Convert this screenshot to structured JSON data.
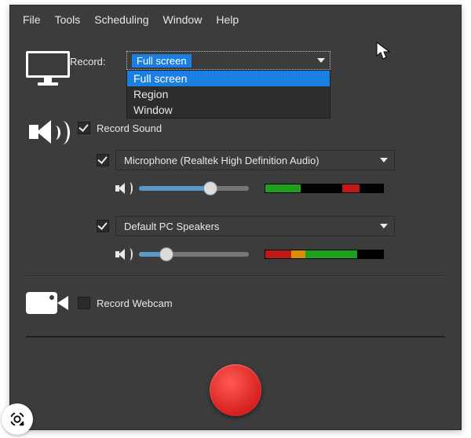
{
  "menu": {
    "file": "File",
    "tools": "Tools",
    "scheduling": "Scheduling",
    "window": "Window",
    "help": "Help"
  },
  "record_section": {
    "label": "Record:",
    "selected": "Full screen",
    "options": [
      "Full screen",
      "Region",
      "Window"
    ]
  },
  "sound_section": {
    "record_sound_label": "Record Sound",
    "record_sound_checked": true,
    "mic": {
      "enabled": true,
      "device": "Microphone (Realtek High Definition Audio)",
      "volume_percent": 65,
      "meter": [
        {
          "color": "#1ea01e",
          "from": 0,
          "to": 30
        },
        {
          "color": "#000000",
          "from": 30,
          "to": 65
        },
        {
          "color": "#c01818",
          "from": 65,
          "to": 80
        },
        {
          "color": "#000000",
          "from": 80,
          "to": 100
        }
      ]
    },
    "speakers": {
      "enabled": true,
      "device": "Default PC Speakers",
      "volume_percent": 25,
      "meter": [
        {
          "color": "#c01818",
          "from": 0,
          "to": 22
        },
        {
          "color": "#d89000",
          "from": 22,
          "to": 34
        },
        {
          "color": "#1ea01e",
          "from": 34,
          "to": 78
        },
        {
          "color": "#000000",
          "from": 78,
          "to": 100
        }
      ]
    }
  },
  "webcam_section": {
    "label": "Record Webcam",
    "checked": false
  }
}
